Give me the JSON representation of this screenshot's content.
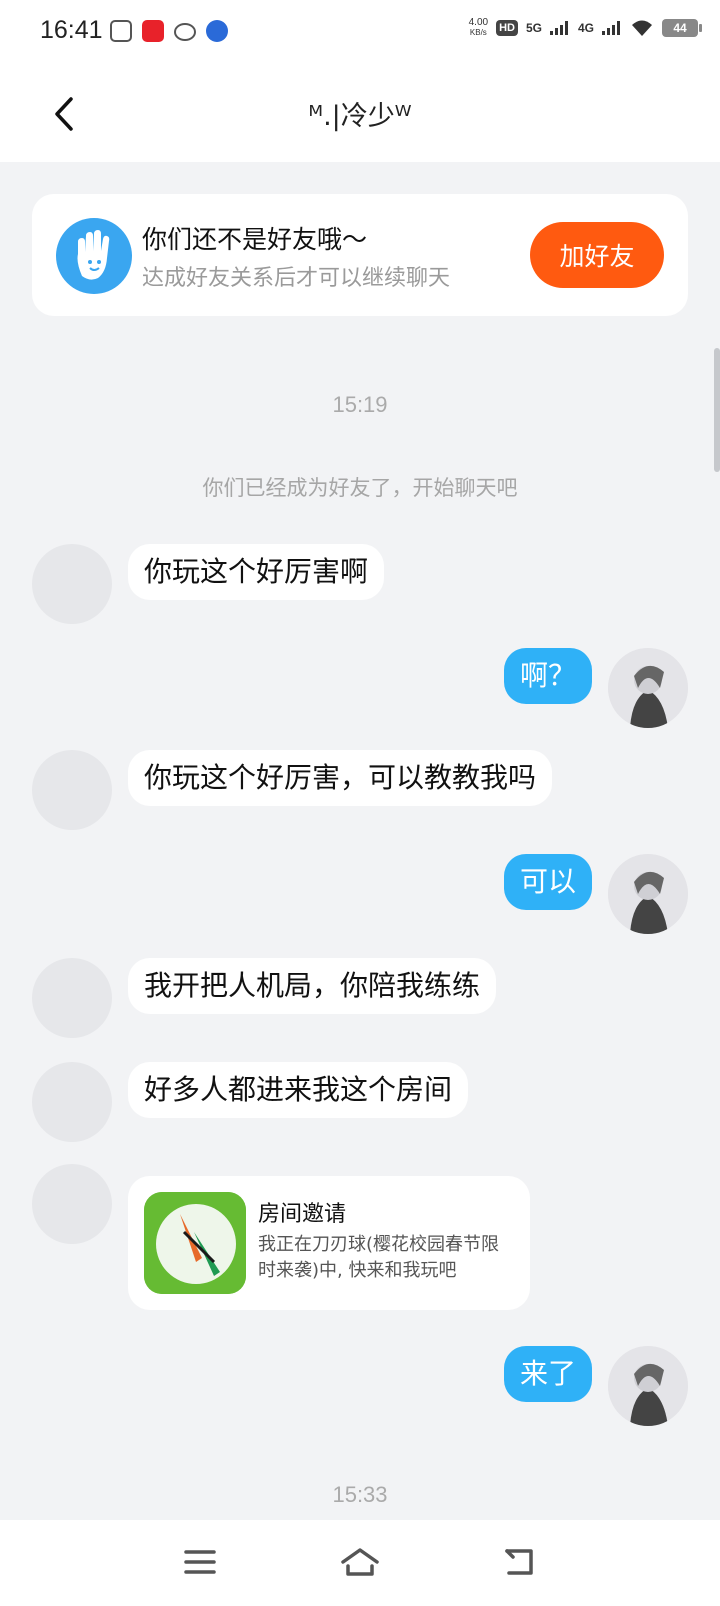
{
  "status_bar": {
    "time": "16:41",
    "net_speed_value": "4.00",
    "net_speed_unit": "KB/s",
    "hd_label": "HD",
    "sim1": "5G",
    "sim2": "4G",
    "battery": "44",
    "icons": [
      "app-icon-1",
      "app-icon-2",
      "app-icon-3",
      "app-icon-4",
      "hd-icon",
      "signal-5g-icon",
      "signal-4g-icon",
      "wifi-icon",
      "battery-icon"
    ]
  },
  "header": {
    "title": "ᴹ.|冷少ᵂ",
    "back_icon": "chevron-left-icon"
  },
  "friend_banner": {
    "title": "你们还不是好友哦～",
    "subtitle": "达成好友关系后才可以继续聊天",
    "button": "加好友",
    "icon": "hand-icon",
    "button_color": "#ff5a10"
  },
  "chat": {
    "timestamp_1": "15:19",
    "system_message": "你们已经成为好友了，开始聊天吧",
    "messages": [
      {
        "from": "them",
        "text": "你玩这个好厉害啊"
      },
      {
        "from": "me",
        "text": "啊？"
      },
      {
        "from": "them",
        "text": "你玩这个好厉害，可以教教我吗"
      },
      {
        "from": "me",
        "text": "可以"
      },
      {
        "from": "them",
        "text": "我开把人机局，你陪我练练"
      },
      {
        "from": "them",
        "text": "好多人都进来我这个房间"
      },
      {
        "from": "me",
        "text": "来了"
      }
    ],
    "invite": {
      "title": "房间邀请",
      "description": "我正在刀刃球(樱花校园春节限时来袭)中, 快来和我玩吧"
    },
    "timestamp_2": "15:33",
    "bubble_out_color": "#2fb1f7"
  },
  "nav_bar": {
    "icons": [
      "menu-icon",
      "home-icon",
      "back-icon"
    ]
  }
}
